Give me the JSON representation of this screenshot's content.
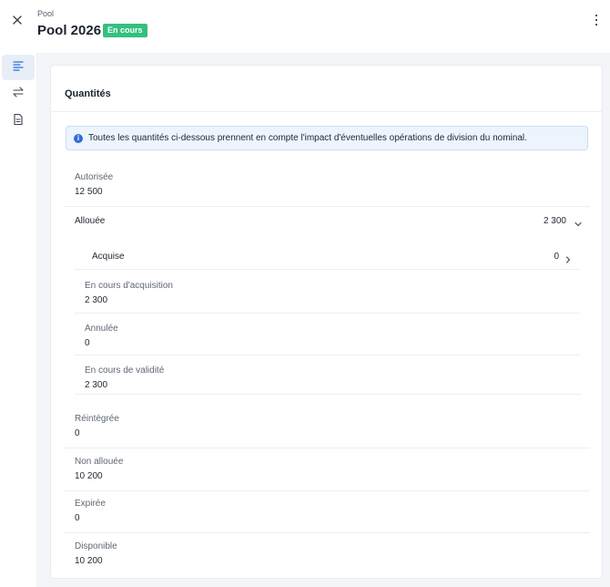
{
  "header": {
    "breadcrumb": "Pool",
    "title": "Pool 2026",
    "status_badge": "En cours",
    "status_color": "#33c07f"
  },
  "sidebar": {
    "items": [
      {
        "icon": "list-icon",
        "active": true
      },
      {
        "icon": "swap-arrows-icon",
        "active": false
      },
      {
        "icon": "document-icon",
        "active": false
      }
    ]
  },
  "card": {
    "title": "Quantités",
    "info": "Toutes les quantités ci-dessous prennent en compte l'impact d'éventuelles opérations de division du nominal."
  },
  "quantities": {
    "autorisee": {
      "label": "Autorisée",
      "value": "12 500"
    },
    "allouee": {
      "label": "Allouée",
      "value": "2 300"
    },
    "acquise": {
      "label": "Acquise",
      "value": "0"
    },
    "en_cours_acquisition": {
      "label": "En cours d'acquisition",
      "value": "2 300"
    },
    "annulee": {
      "label": "Annulée",
      "value": "0"
    },
    "en_cours_validite": {
      "label": "En cours de validité",
      "value": "2 300"
    },
    "reintegree": {
      "label": "Réintégrée",
      "value": "0"
    },
    "non_allouee": {
      "label": "Non allouée",
      "value": "10 200"
    },
    "expiree": {
      "label": "Expirée",
      "value": "0"
    },
    "disponible": {
      "label": "Disponible",
      "value": "10 200"
    }
  }
}
